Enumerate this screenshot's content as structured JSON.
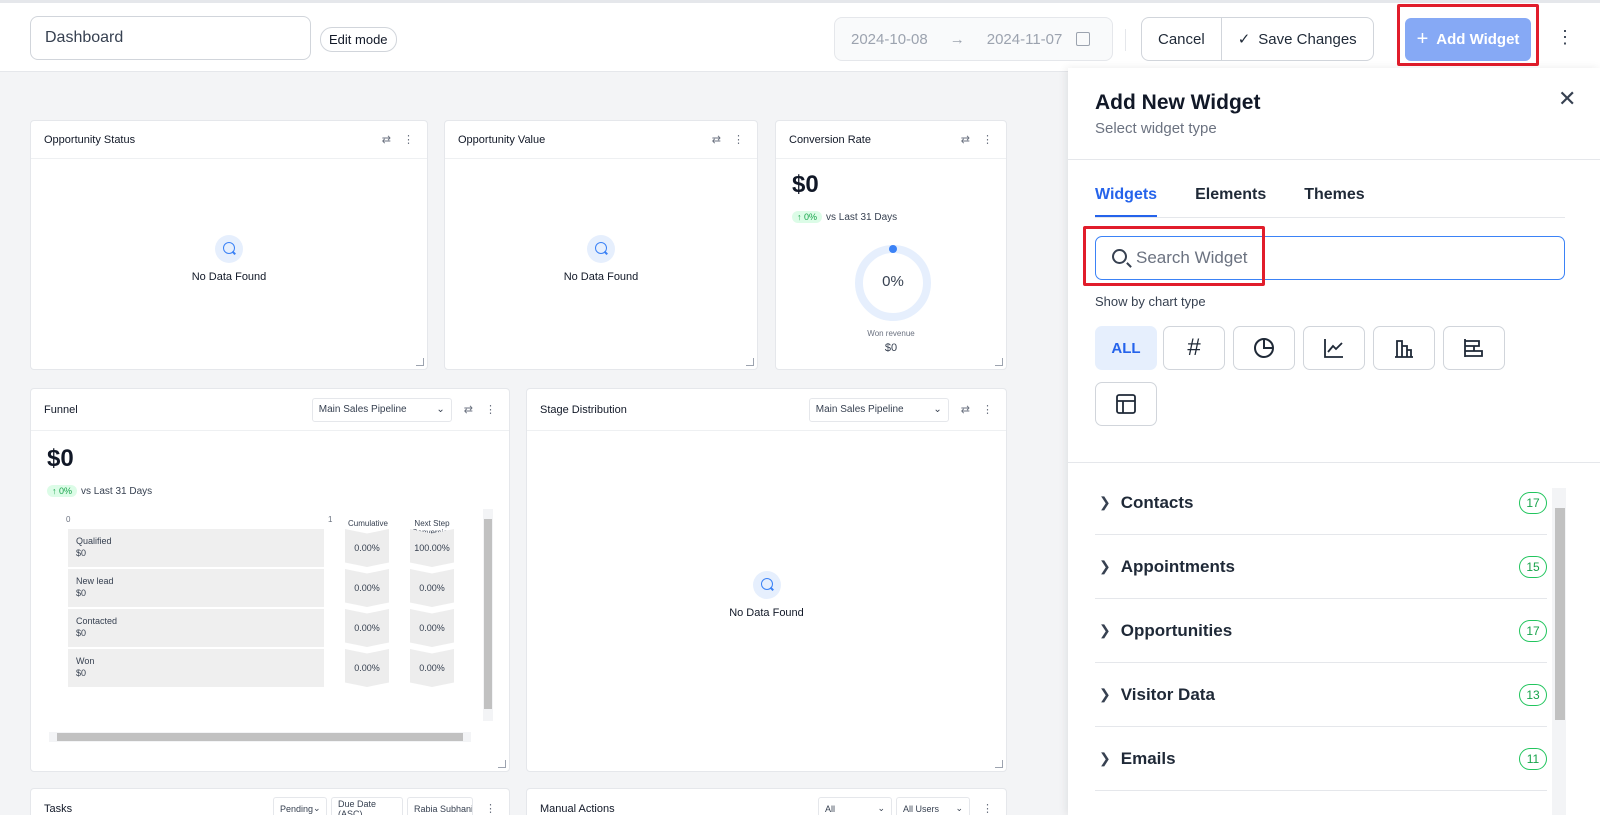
{
  "topbar": {
    "dashboard_name": "Dashboard",
    "edit_mode": "Edit mode",
    "date_from": "2024-10-08",
    "date_arrow": "→",
    "date_to": "2024-11-07",
    "cancel": "Cancel",
    "save_icon": "✓",
    "save": "Save Changes",
    "add_icon": "+",
    "add_widget": "Add Widget",
    "more": "⋮"
  },
  "widgets": {
    "opp_status": {
      "title": "Opportunity Status",
      "empty": "No Data Found"
    },
    "opp_value": {
      "title": "Opportunity Value",
      "empty": "No Data Found"
    },
    "conversion": {
      "title": "Conversion Rate",
      "value": "$0",
      "delta": "↑ 0%",
      "vs": "vs Last 31 Days",
      "gauge": "0%",
      "gauge_fill": 0,
      "won_label": "Won revenue",
      "won_value": "$0"
    },
    "funnel": {
      "title": "Funnel",
      "pipeline": "Main Sales Pipeline",
      "value": "$0",
      "delta": "↑ 0%",
      "vs": "vs Last 31 Days",
      "axis_min": "0",
      "axis_max": "1",
      "col_cumulative": "Cumulative",
      "col_next": "Next Step Conversion",
      "stages": [
        {
          "name": "Qualified",
          "value": "$0",
          "cumulative": "0.00%",
          "next": "100.00%"
        },
        {
          "name": "New lead",
          "value": "$0",
          "cumulative": "0.00%",
          "next": "0.00%"
        },
        {
          "name": "Contacted",
          "value": "$0",
          "cumulative": "0.00%",
          "next": "0.00%"
        },
        {
          "name": "Won",
          "value": "$0",
          "cumulative": "0.00%",
          "next": "0.00%"
        }
      ]
    },
    "stage_dist": {
      "title": "Stage Distribution",
      "pipeline": "Main Sales Pipeline",
      "empty": "No Data Found"
    },
    "tasks": {
      "title": "Tasks",
      "filter1": "Pending",
      "filter2": "Due Date (ASC)",
      "filter3": "Rabia Subhani"
    },
    "manual": {
      "title": "Manual Actions",
      "filter1": "All",
      "filter2": "All Users"
    }
  },
  "panel": {
    "title": "Add New Widget",
    "subtitle": "Select widget type",
    "close": "✕",
    "tabs": [
      "Widgets",
      "Elements",
      "Themes"
    ],
    "search_placeholder": "Search Widget",
    "show_by": "Show by chart type",
    "chart_types": [
      "ALL",
      "#"
    ],
    "categories": [
      {
        "label": "Contacts",
        "count": "17"
      },
      {
        "label": "Appointments",
        "count": "15"
      },
      {
        "label": "Opportunities",
        "count": "17"
      },
      {
        "label": "Visitor Data",
        "count": "13"
      },
      {
        "label": "Emails",
        "count": "11"
      }
    ]
  }
}
